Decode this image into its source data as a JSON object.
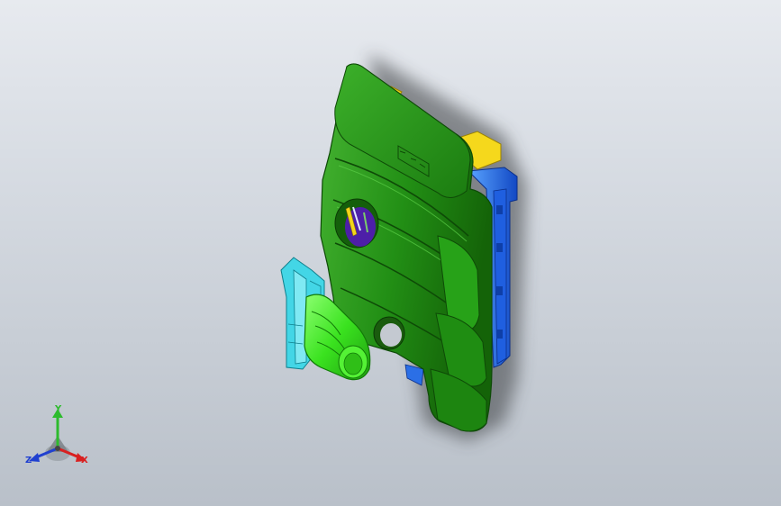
{
  "viewport": {
    "background_top": "#e7eaef",
    "background_bottom": "#b9c0c9"
  },
  "model": {
    "colors": {
      "shell_green": "#239a16",
      "shell_dark": "#145f0b",
      "shell_light": "#52c63e",
      "bracket_blue": "#1e6fe0",
      "bracket_cyan": "#43d6e6",
      "duct_lime": "#39ea1e",
      "tab_yellow": "#f3d51a",
      "inner_purple": "#4d1fa8"
    }
  },
  "triad": {
    "x_label": "X",
    "y_label": "Y",
    "z_label": "Z",
    "x_color": "#d92020",
    "y_color": "#2dbb2d",
    "z_color": "#2040d0"
  }
}
